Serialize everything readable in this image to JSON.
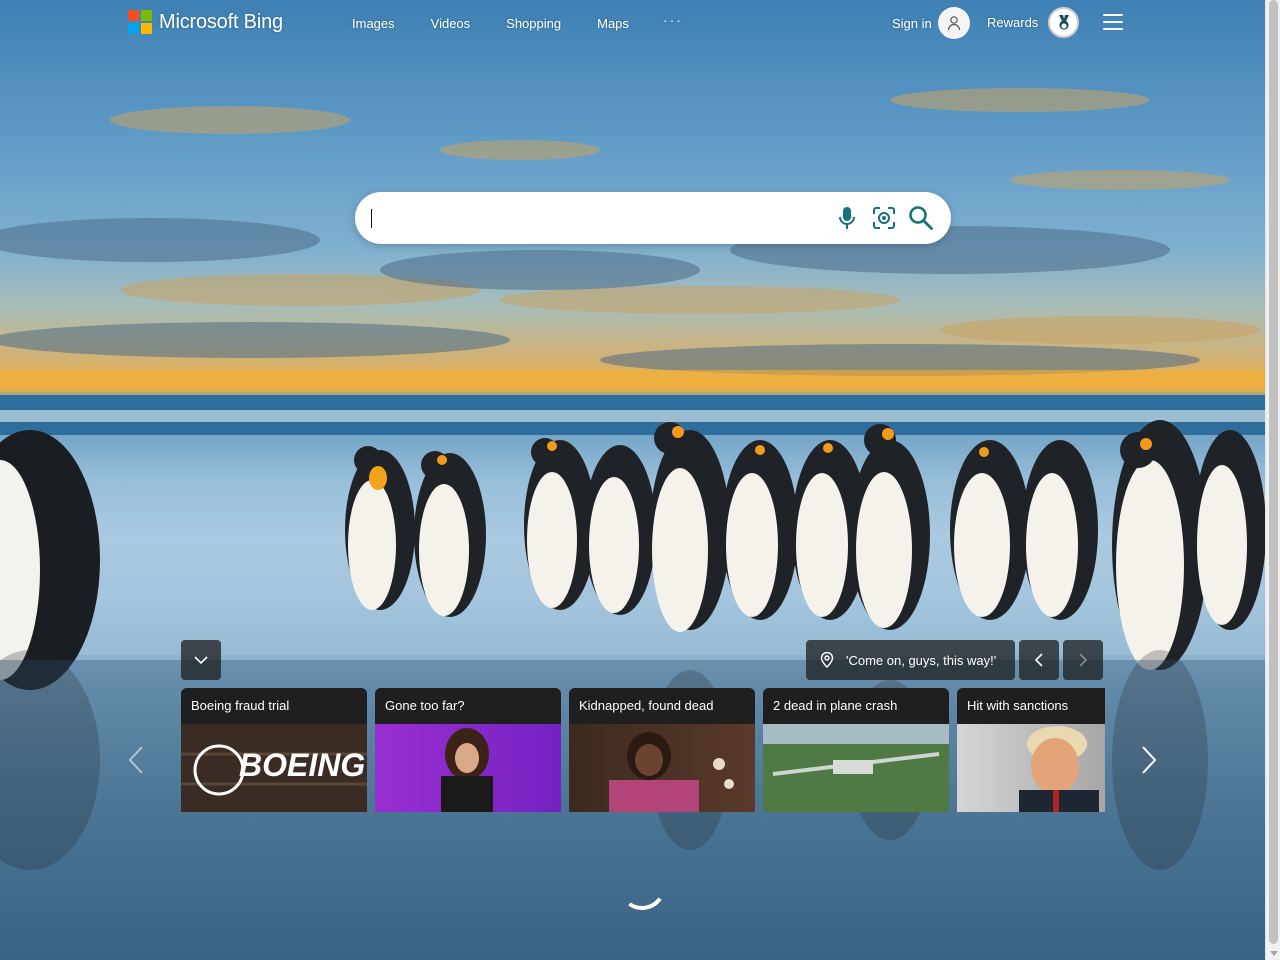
{
  "header": {
    "brand": "Microsoft Bing",
    "nav": [
      {
        "label": "Images"
      },
      {
        "label": "Videos"
      },
      {
        "label": "Shopping"
      },
      {
        "label": "Maps"
      }
    ],
    "more_label": "···",
    "signin_label": "Sign in",
    "rewards_label": "Rewards"
  },
  "search": {
    "placeholder": "",
    "value": ""
  },
  "image": {
    "caption": "'Come on, guys, this way!'"
  },
  "cards": [
    {
      "title": "Boeing fraud trial",
      "thumb_text": "BOEING"
    },
    {
      "title": "Gone too far?"
    },
    {
      "title": "Kidnapped, found dead"
    },
    {
      "title": "2 dead in plane crash"
    },
    {
      "title": "Hit with sanctions"
    }
  ],
  "colors": {
    "ms_red": "#f25022",
    "ms_green": "#7fba00",
    "ms_blue": "#00a4ef",
    "ms_yellow": "#ffb900",
    "search_icon": "#17717e"
  },
  "icons": {
    "mic": "microphone-icon",
    "visual_search": "visual-search-icon",
    "search": "search-icon",
    "location": "location-pin-icon"
  }
}
